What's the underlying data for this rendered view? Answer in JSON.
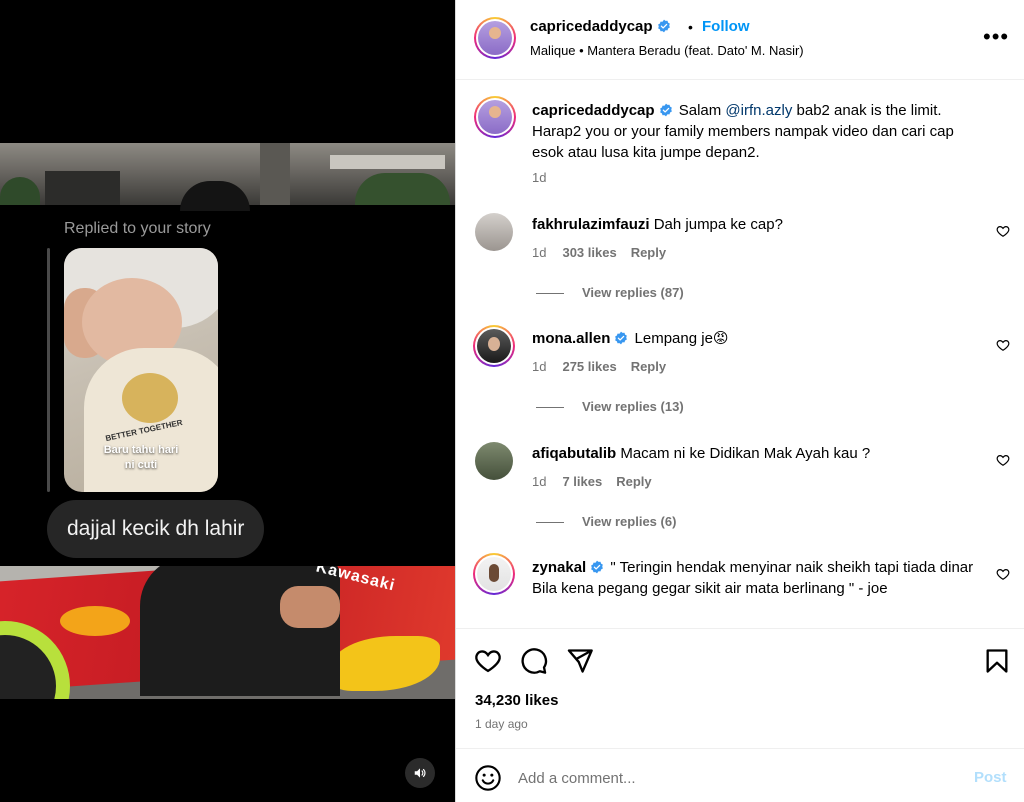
{
  "media": {
    "replied_label": "Replied to your story",
    "story_caption_line1": "Baru tahu hari",
    "story_caption_line2": "ni cuti",
    "story_shirt_text": "BETTER TOGETHER",
    "message": "dajjal kecik dh lahir",
    "bike_brand": "Kawasaki",
    "sound_icon": "speaker-icon"
  },
  "header": {
    "username": "capricedaddycap",
    "follow_label": "Follow",
    "song": "Malique • Mantera Beradu (feat. Dato' M. Nasir)",
    "more_label": "•••"
  },
  "caption": {
    "username": "capricedaddycap",
    "text_before": "Salam ",
    "mention": "@irfn.azly",
    "text_after": " bab2 anak is the limit. Harap2 you or your family members nampak video dan cari cap esok atau lusa kita jumpe depan2.",
    "time": "1d"
  },
  "comments": [
    {
      "username": "fakhrulazimfauzi",
      "text": "Dah jumpa ke cap?",
      "time": "1d",
      "likes": "303 likes",
      "reply": "Reply",
      "view_replies": "View replies (87)"
    },
    {
      "username": "mona.allen",
      "text": "Lempang je😡",
      "time": "1d",
      "likes": "275 likes",
      "reply": "Reply",
      "view_replies": "View replies (13)"
    },
    {
      "username": "afiqabutalib",
      "text": "Macam ni ke Didikan Mak Ayah kau ?",
      "time": "1d",
      "likes": "7 likes",
      "reply": "Reply",
      "view_replies": "View replies (6)"
    },
    {
      "username": "zynakal",
      "text": "\" Teringin hendak menyinar naik sheikh tapi tiada dinar",
      "text2": "Bila kena pegang gegar sikit air mata berlinang \" - joe"
    }
  ],
  "footer": {
    "likes": "34,230 likes",
    "ago": "1 day ago",
    "comment_placeholder": "Add a comment...",
    "post_label": "Post"
  },
  "colors": {
    "accent": "#0095f6",
    "verified": "#3897f0",
    "mention": "#00376b",
    "muted": "#737373"
  }
}
